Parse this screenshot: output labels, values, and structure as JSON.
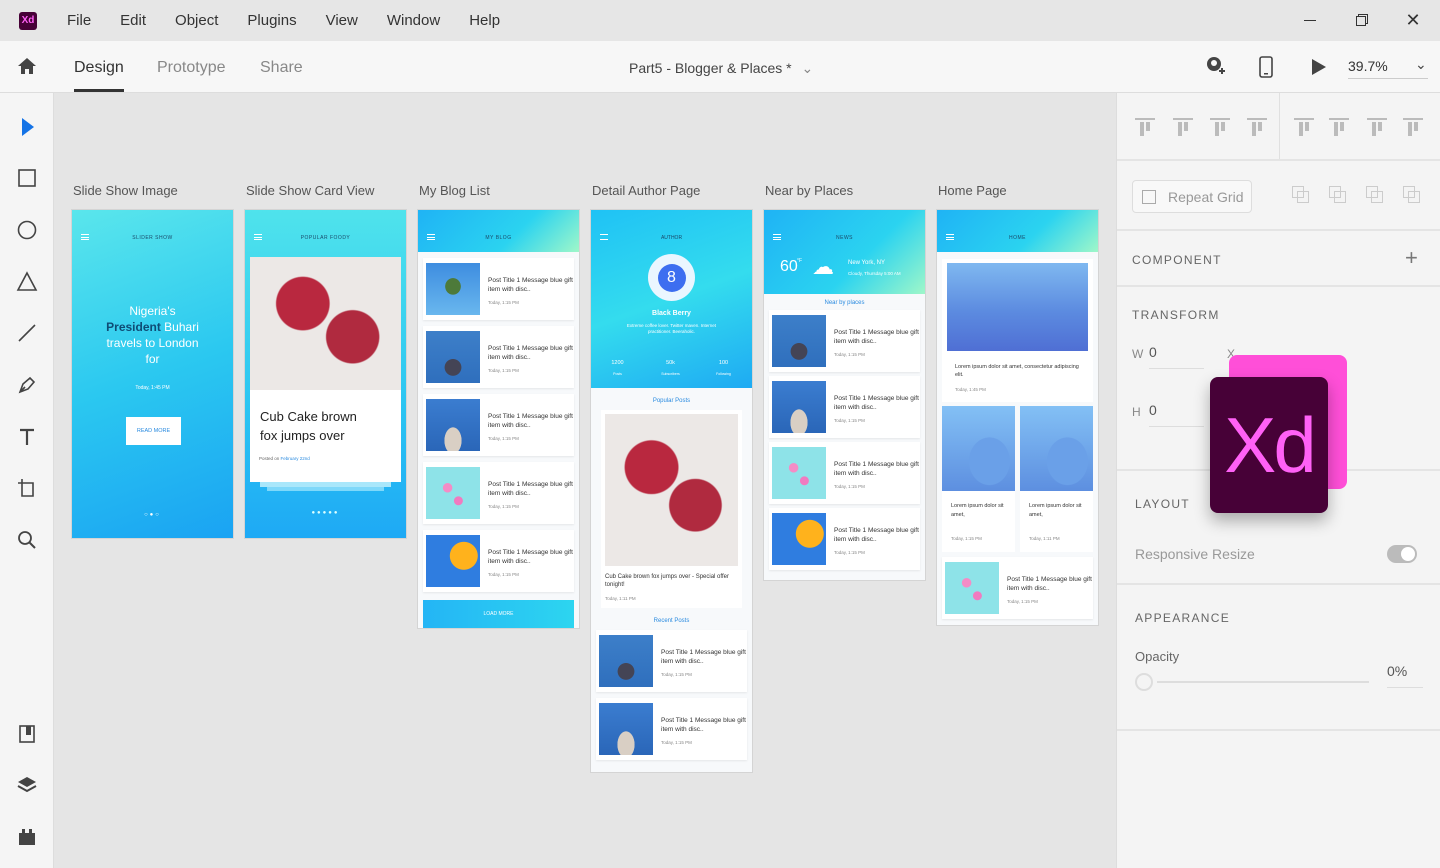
{
  "app": {
    "logo_text": "Xd",
    "menu": [
      "File",
      "Edit",
      "Object",
      "Plugins",
      "View",
      "Window",
      "Help"
    ]
  },
  "toolbar": {
    "tabs": [
      {
        "label": "Design",
        "active": true
      },
      {
        "label": "Prototype"
      },
      {
        "label": "Share"
      }
    ],
    "doc_title": "Part5 - Blogger & Places *",
    "zoom": "39.7%"
  },
  "left_tools": [
    "select",
    "rectangle",
    "ellipse",
    "polygon",
    "line",
    "pen",
    "text",
    "artboard",
    "zoom",
    "assets",
    "layers",
    "plugins"
  ],
  "artboards": [
    {
      "label": "Slide Show Image",
      "header": "SLIDER SHOW",
      "headline_1": "Nigeria's",
      "headline_bold": "President",
      "headline_2": "Buhari",
      "headline_3": "travels to London",
      "headline_4": "for",
      "date": "Today, 1:45 PM",
      "button": "READ MORE"
    },
    {
      "label": "Slide Show Card View",
      "header": "POPULAR FOODY",
      "card_title_1": "Cub Cake brown",
      "card_title_2": "fox jumps over",
      "posted_prefix": "Posted on",
      "posted_date": "February 22nd"
    },
    {
      "label": "My Blog List",
      "header": "MY BLOG",
      "rows": [
        {
          "title": "Post Title 1 Message blue gift item with disc..",
          "date": "Today, 1:15 PM",
          "img": "cactus"
        },
        {
          "title": "Post Title 1 Message blue gift item with disc..",
          "date": "Today, 1:15 PM",
          "img": "plant"
        },
        {
          "title": "Post Title 1 Message blue gift item with disc..",
          "date": "Today, 1:15 PM",
          "img": "plant2"
        },
        {
          "title": "Post Title 1 Message blue gift item with disc..",
          "date": "Today, 1:15 PM",
          "img": "flower"
        },
        {
          "title": "Post Title 1 Message blue gift item with disc..",
          "date": "Today, 1:15 PM",
          "img": "orange"
        }
      ],
      "button": "LOAD MORE"
    },
    {
      "label": "Detail Author Page",
      "header": "AUTHOR",
      "name": "Black Berry",
      "bio": "Extreme coffee lover. Twitter maven. Internet practitioner. Beeraholic.",
      "stats": [
        {
          "value": "1200",
          "label": "Posts"
        },
        {
          "value": "50k",
          "label": "Subscribers"
        },
        {
          "value": "100",
          "label": "Following"
        }
      ],
      "popular_title": "Popular Posts",
      "popular_caption": "Cub Cake brown fox jumps over - Special offer tonight!",
      "popular_date": "Today, 1:11 PM",
      "recent_title": "Recent Posts",
      "rows": [
        {
          "title": "Post Title 1 Message blue gift item with disc..",
          "date": "Today, 1:15 PM",
          "img": "plant"
        },
        {
          "title": "Post Title 1 Message blue gift item with disc..",
          "date": "Today, 1:15 PM",
          "img": "plant2"
        }
      ]
    },
    {
      "label": "Near by Places",
      "header": "NEWS",
      "temp": "60",
      "unit": "°F",
      "city": "New York, NY",
      "weather": "Cloudy, Thursday 5:00 AM",
      "section": "Near by places",
      "rows": [
        {
          "title": "Post Title 1 Message blue gift item with disc..",
          "date": "Today, 1:15 PM",
          "img": "plant"
        },
        {
          "title": "Post Title 1 Message blue gift item with disc..",
          "date": "Today, 1:15 PM",
          "img": "plant2"
        },
        {
          "title": "Post Title 1 Message blue gift item with disc..",
          "date": "Today, 1:15 PM",
          "img": "flower"
        },
        {
          "title": "Post Title 1 Message blue gift item with disc..",
          "date": "Today, 1:15 PM",
          "img": "orange"
        }
      ]
    },
    {
      "label": "Home Page",
      "header": "HOME",
      "hero_text": "Lorem ipsum dolor sit amet, consectetur adipiscing elit.",
      "hero_date": "Today, 1:45 PM",
      "cards": [
        {
          "text": "Lorem ipsum dolor sit amet,",
          "date": "Today, 1:15 PM"
        },
        {
          "text": "Lorem ipsum dolor sit amet,",
          "date": "Today, 1:11 PM"
        }
      ],
      "rows": [
        {
          "title": "Post Title 1 Message blue gift item with disc..",
          "date": "Today, 1:15 PM",
          "img": "flower"
        }
      ]
    }
  ],
  "panel": {
    "repeat_grid": "Repeat Grid",
    "component": "COMPONENT",
    "transform": "TRANSFORM",
    "w_label": "W",
    "w_value": "0",
    "h_label": "H",
    "h_value": "0",
    "x_label": "X",
    "x_value": "0",
    "layout": "LAYOUT",
    "responsive_resize": "Responsive Resize",
    "responsive_on": true,
    "appearance": "APPEARANCE",
    "opacity_label": "Opacity",
    "opacity_value": "0%",
    "opacity_level": 0
  },
  "overlay_logo": {
    "text": "Xd",
    "colors": {
      "bg": "#470137",
      "fg": "#ff61f6",
      "back": "#ff4fd8"
    }
  },
  "colors": {
    "accent": "#2680eb",
    "header_gradient": [
      "#1fb3f5",
      "#2bd3f0",
      "#9ff7c9"
    ]
  }
}
